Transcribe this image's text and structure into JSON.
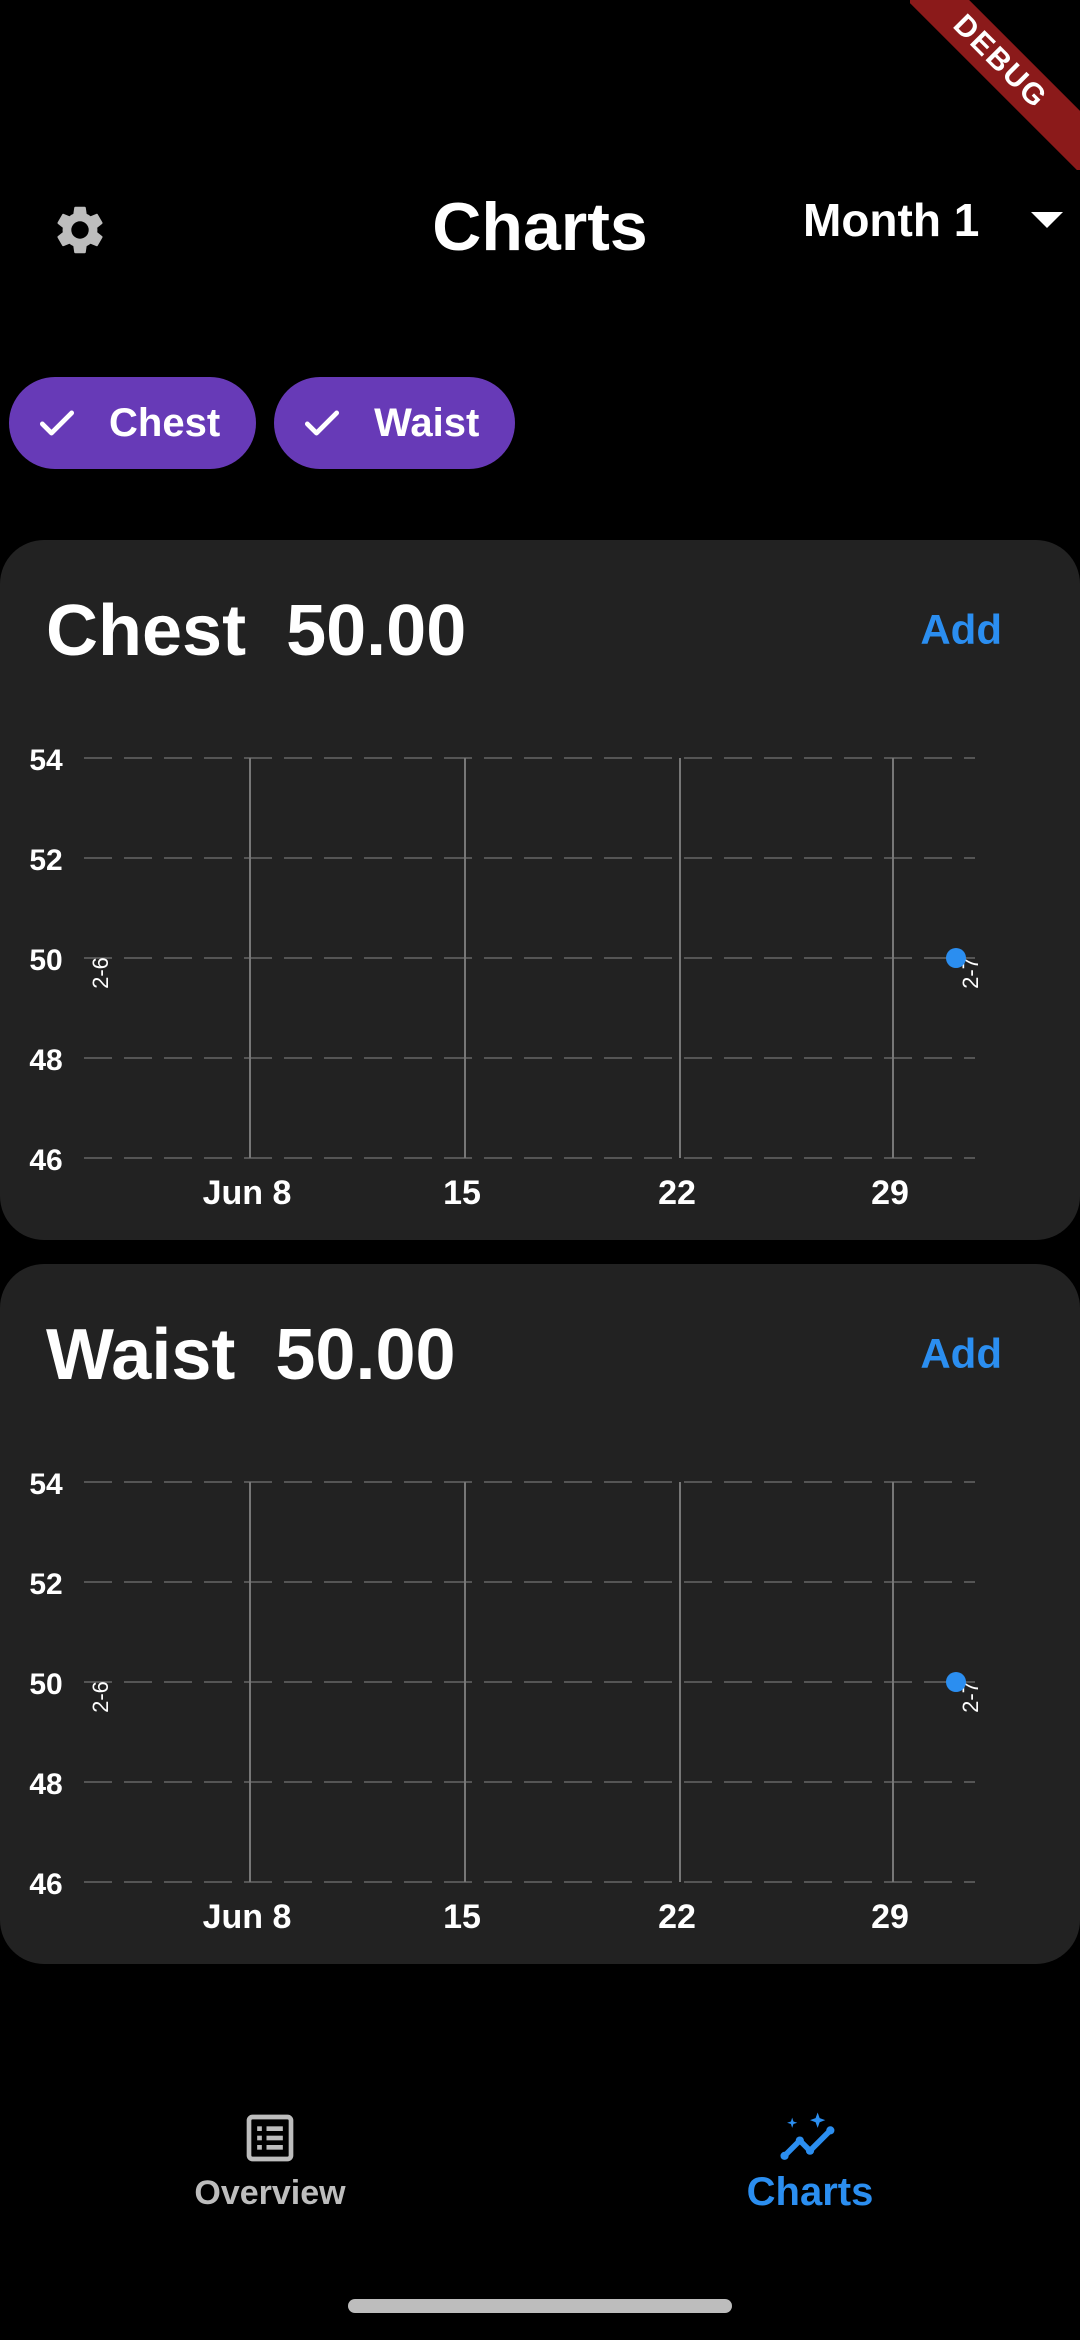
{
  "debug_banner": "DEBUG",
  "app_bar": {
    "title": "Charts",
    "month_selector": "Month 1",
    "settings_icon": "gear-icon",
    "dropdown_icon": "caret-down-icon"
  },
  "filters": [
    {
      "label": "Chest",
      "selected": true
    },
    {
      "label": "Waist",
      "selected": true
    }
  ],
  "cards": [
    {
      "name": "Chest",
      "value": "50.00",
      "add_label": "Add"
    },
    {
      "name": "Waist",
      "value": "50.00",
      "add_label": "Add"
    }
  ],
  "chart_data": [
    {
      "type": "scatter",
      "title": "Chest 50.00",
      "x_tick_labels": [
        "Jun 8",
        "15",
        "22",
        "29"
      ],
      "y_ticks": [
        54,
        52,
        50,
        48,
        46
      ],
      "ylim": [
        46,
        54
      ],
      "grid": true,
      "side_labels": [
        "2-6",
        "2-7"
      ],
      "series": [
        {
          "values": [
            {
              "x": "Jul 2",
              "y": 50
            }
          ]
        }
      ],
      "point_color": "#2b8ef0"
    },
    {
      "type": "scatter",
      "title": "Waist 50.00",
      "x_tick_labels": [
        "Jun 8",
        "15",
        "22",
        "29"
      ],
      "y_ticks": [
        54,
        52,
        50,
        48,
        46
      ],
      "ylim": [
        46,
        54
      ],
      "grid": true,
      "side_labels": [
        "2-6",
        "2-7"
      ],
      "series": [
        {
          "values": [
            {
              "x": "Jul 2",
              "y": 50
            }
          ]
        }
      ],
      "point_color": "#2b8ef0"
    }
  ],
  "bottom_nav": [
    {
      "label": "Overview",
      "icon": "list-icon",
      "active": false
    },
    {
      "label": "Charts",
      "icon": "insights-icon",
      "active": true
    }
  ],
  "colors": {
    "accent": "#673ab7",
    "link": "#2b8ef0",
    "card": "#222222",
    "inactive": "#bdbdbd"
  }
}
